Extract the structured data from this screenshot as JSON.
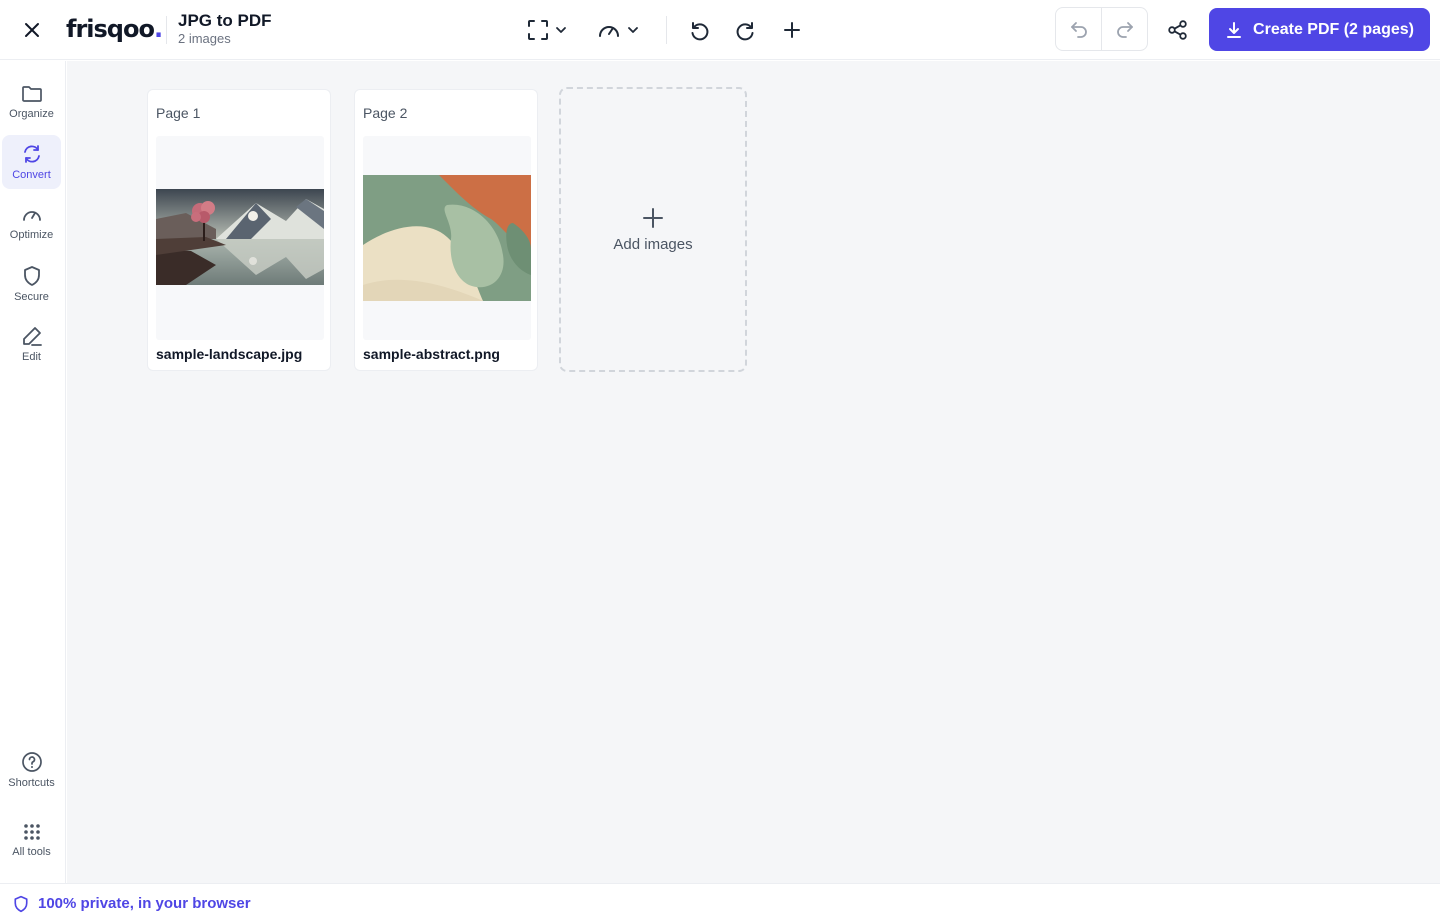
{
  "app": {
    "logo_text": "frisqoo",
    "logo_dot": ".",
    "document_title": "JPG to PDF",
    "document_subtitle": "2 images"
  },
  "toolbar": {
    "create_label": "Create PDF (2 pages)",
    "accent_color": "#4f46e5"
  },
  "sidebar": {
    "items": [
      {
        "label": "Organize",
        "icon": "folder-icon",
        "active": false
      },
      {
        "label": "Convert",
        "icon": "refresh-icon",
        "active": true
      },
      {
        "label": "Optimize",
        "icon": "gauge-icon",
        "active": false
      },
      {
        "label": "Secure",
        "icon": "shield-icon",
        "active": false
      },
      {
        "label": "Edit",
        "icon": "pen-icon",
        "active": false
      }
    ],
    "bottom_items": [
      {
        "label": "Shortcuts",
        "icon": "help-circle-icon"
      },
      {
        "label": "All tools",
        "icon": "grid-dots-icon"
      }
    ]
  },
  "pages": [
    {
      "label": "Page 1",
      "file_name": "sample-landscape.jpg"
    },
    {
      "label": "Page 2",
      "file_name": "sample-abstract.png"
    }
  ],
  "add_card": {
    "label": "Add images"
  },
  "footer": {
    "privacy_text": "100% private, in your browser"
  }
}
